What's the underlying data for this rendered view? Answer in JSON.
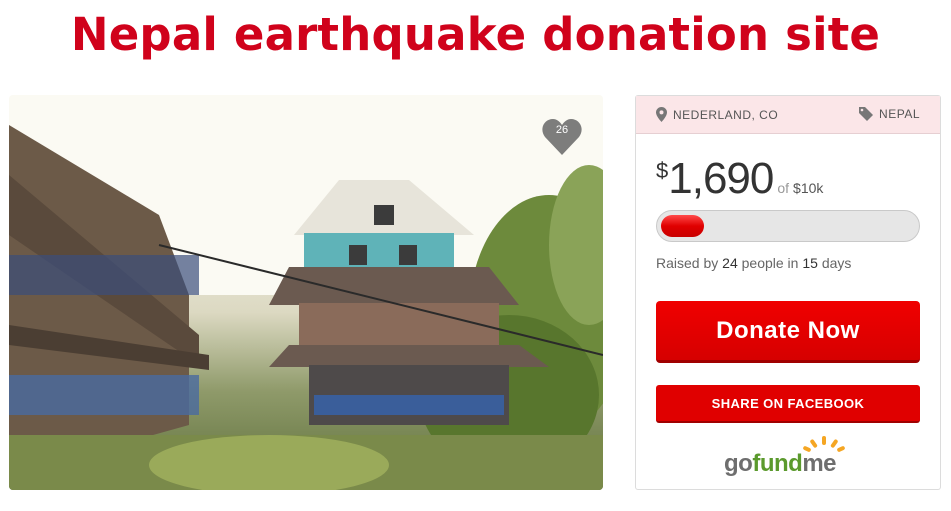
{
  "page": {
    "title": "Nepal earthquake donation site"
  },
  "photo": {
    "favorite_count": "26"
  },
  "campaign": {
    "location": "NEDERLAND, CO",
    "category": "NEPAL",
    "currency_symbol": "$",
    "amount_raised": "1,690",
    "of_label": "of",
    "goal": "$10k",
    "progress_fraction": 0.169,
    "raised_prefix": "Raised by",
    "donor_count": "24",
    "people_label": "people in",
    "days": "15",
    "days_label": "days"
  },
  "actions": {
    "donate_label": "Donate Now",
    "share_label": "SHARE ON FACEBOOK"
  },
  "brand": {
    "part1": "go",
    "part2": "fund",
    "part3": "me"
  },
  "colors": {
    "accent": "#d0021b",
    "button": "#e00000",
    "brand_green": "#5b9a2d",
    "brand_orange": "#f5a623"
  },
  "icons": {
    "location": "map-pin-icon",
    "category": "tag-icon",
    "favorite": "heart-icon"
  }
}
